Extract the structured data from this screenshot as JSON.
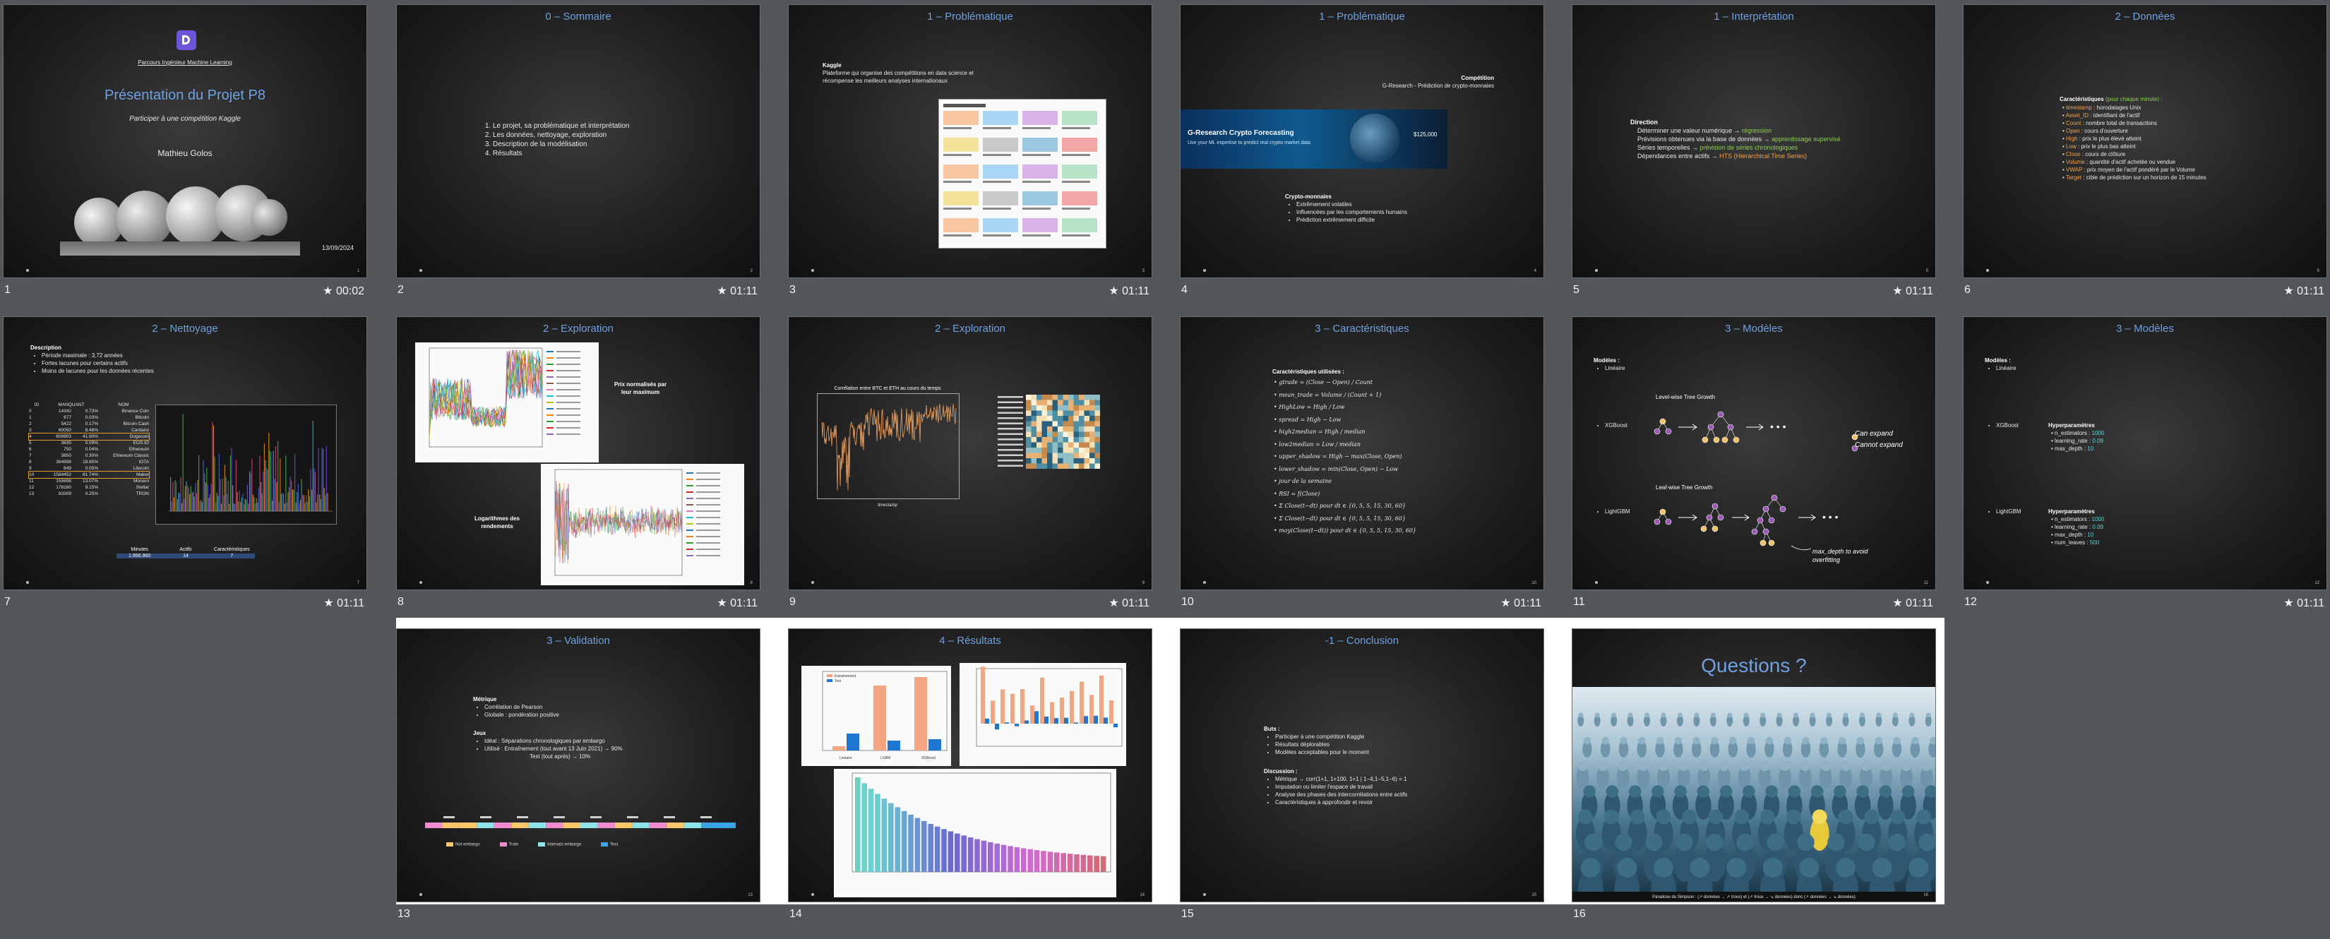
{
  "slides": [
    {
      "num": "1",
      "time": "★ 00:02",
      "slide_no": "1",
      "logo_org": "Parcours Ingénieur Machine Learning",
      "title": "Présentation du Projet P8",
      "subtitle": "Participer à une compétition Kaggle",
      "author": "Mathieu Golos",
      "date": "13/09/2024"
    },
    {
      "num": "2",
      "time": "★ 01:11",
      "title": "0 – Sommaire",
      "slide_no": "2",
      "items": [
        "Le projet, sa problématique et interprétation",
        "Les données, nettoyage, exploration",
        "Description de la modélisation",
        "Résultats"
      ]
    },
    {
      "num": "3",
      "time": "★ 01:11",
      "title": "1 – Problématique",
      "slide_no": "3",
      "kaggle_head": "Kaggle",
      "kaggle_text": "Plateforme qui organise des compétitions en data science et récompense les meilleurs analyses internationaux"
    },
    {
      "num": "4",
      "time": "",
      "title": "1 – Problématique",
      "slide_no": "4",
      "comp_head": "Compétition",
      "comp_text": "G-Research - Prédiction de crypto-monnaies",
      "banner_title": "G-Research Crypto Forecasting",
      "banner_sub": "Use your ML expertise to predict real crypto market data",
      "banner_prize": "$125,000",
      "crypto_head": "Crypto-monnaies",
      "crypto_items": [
        "Extrêmement volatiles",
        "Influencées par les comportements humains",
        "Prédiction extrêmement difficile"
      ]
    },
    {
      "num": "5",
      "time": "★ 01:11",
      "title": "1 – Interprétation",
      "slide_no": "5",
      "dir_head": "Direction",
      "lines": [
        {
          "a": "Déterminer une valeur numérique → ",
          "b": "régression",
          "cls": "hl-g"
        },
        {
          "a": "Prévisions obtenues via la base de données → ",
          "b": "apprentissage supervisé",
          "cls": "hl-g"
        },
        {
          "a": "Séries temporelles → ",
          "b": "prévision de séries chronologiques",
          "cls": "hl-g"
        },
        {
          "a": "Dépendances entre actifs → ",
          "b": "HTS (Hierarchical Time Series)",
          "cls": "hl-o"
        }
      ]
    },
    {
      "num": "6",
      "time": "★ 01:11",
      "title": "2 – Données",
      "slide_no": "6",
      "car_head": "Caractéristiques",
      "car_sub": "(pour chaque minute) :",
      "features": [
        {
          "k": "timestamp",
          "v": " : horodatages Unix"
        },
        {
          "k": "Asset_ID",
          "v": " : identifiant de l'actif"
        },
        {
          "k": "Count",
          "v": " : nombre total de transactions"
        },
        {
          "k": "Open",
          "v": " : cours d'ouverture"
        },
        {
          "k": "High",
          "v": " : prix le plus élevé atteint"
        },
        {
          "k": "Low",
          "v": " : prix le plus bas atteint"
        },
        {
          "k": "Close",
          "v": " : cours de clôture"
        },
        {
          "k": "Volume",
          "v": " : quantité d'actif achetée ou vendue"
        },
        {
          "k": "VWAP",
          "v": " : prix moyen de l'actif pondéré par le Volume"
        },
        {
          "k": "Target",
          "v": " : cible de prédiction sur un horizon de 15 minutes"
        }
      ]
    },
    {
      "num": "7",
      "time": "★ 01:11",
      "title": "2 – Nettoyage",
      "slide_no": "7",
      "desc_head": "Description",
      "desc_items": [
        "Période maximale : 3,72 années",
        "Fortes lacunes pour certains actifs",
        "Moins de lacunes pour les données récentes"
      ],
      "table_head": [
        "ID",
        "MANQUANT",
        "NOM"
      ],
      "table_rows": [
        [
          "0",
          "14342",
          "0.73%",
          "Binance Coin"
        ],
        [
          "1",
          "677",
          "0.03%",
          "Bitcoin"
        ],
        [
          "2",
          "5422",
          "0.17%",
          "Bitcoin Cash"
        ],
        [
          "3",
          "60050",
          "8.46%",
          "Cardano"
        ],
        [
          "4",
          "809903",
          "41.90%",
          "Dogecoin"
        ],
        [
          "5",
          "3835",
          "0.09%",
          "EOS.IO"
        ],
        [
          "6",
          "750",
          "0.04%",
          "Ethereum"
        ],
        [
          "7",
          "3850",
          "0.30%",
          "Ethereum Classic"
        ],
        [
          "8",
          "364898",
          "18.85%",
          "IOTA"
        ],
        [
          "9",
          "649",
          "0.05%",
          "Litecoin"
        ],
        [
          "10",
          "1584452",
          "81.74%",
          "Maker"
        ],
        [
          "11",
          "155698",
          "13.07%",
          "Monero"
        ],
        [
          "12",
          "178160",
          "9.15%",
          "Stellar"
        ],
        [
          "13",
          "83309",
          "4.25%",
          "TRON"
        ]
      ],
      "sum_head": [
        "Minutes",
        "Actifs",
        "Caractéristiques"
      ],
      "sum_vals": [
        "1.956.960",
        "14",
        "7"
      ]
    },
    {
      "num": "8",
      "time": "★ 01:11",
      "title": "2 – Exploration",
      "slide_no": "8",
      "lab1": "Prix normalisés par leur maximum",
      "lab2": "Logarithmes des rendements"
    },
    {
      "num": "9",
      "time": "★ 01:11",
      "title": "2 – Exploration",
      "slide_no": "9",
      "chart_title": "Corrélation entre BTC et ETH au cours du temps",
      "xlab": "timestamp"
    },
    {
      "num": "10",
      "time": "★ 01:11",
      "title": "3 – Caractéristiques",
      "slide_no": "10",
      "head": "Caractéristiques utilisées :",
      "formulas": [
        "gtrade = (Close − Open) / Count",
        "mean_trade = Volume / (Count + 1)",
        "HighLow = High / Low",
        "spread = High − Low",
        "high2median = High / median",
        "low2median = Low / median",
        "upper_shadow = High − max(Close, Open)",
        "lower_shadow = min(Close, Open) − Low",
        "jour de la semaine",
        "RSI = f(Close)",
        "Σ Close(t−dt) pour dt ∈ {0, 5, 5, 15, 30, 60}",
        "Σ Close(t−dt) pour dt ∈ {0, 5, 5, 15, 30, 60}",
        "moy(Close(t−dt)) pour dt ∈ {0, 5, 5, 15, 30, 60}"
      ]
    },
    {
      "num": "11",
      "time": "★ 01:11",
      "title": "3 – Modèles",
      "slide_no": "11",
      "models_head": "Modèles :",
      "m1": "Linéaire",
      "m2": "XGBoost",
      "m3": "LightGBM",
      "t1": "Level-wise Tree Growth",
      "t2": "Leaf-wise Tree Growth",
      "can": "Can expand",
      "cannot": "Cannot expand",
      "maxd": "max_depth to avoid overfitting"
    },
    {
      "num": "12",
      "time": "★ 01:11",
      "title": "3 – Modèles",
      "slide_no": "12",
      "models_head": "Modèles :",
      "m1": "Linéaire",
      "m2": "XGBoost",
      "m3": "LightGBM",
      "hp_head": "Hyperparamètres",
      "xgb": [
        {
          "k": "n_estimators : ",
          "v": "1000"
        },
        {
          "k": "learning_rate : ",
          "v": "0.09"
        },
        {
          "k": "max_depth : ",
          "v": "10"
        }
      ],
      "lgb": [
        {
          "k": "n_estimators : ",
          "v": "1000"
        },
        {
          "k": "learning_rate : ",
          "v": "0.09"
        },
        {
          "k": "max_depth : ",
          "v": "10"
        },
        {
          "k": "num_leaves : ",
          "v": "500"
        }
      ]
    },
    {
      "num": "13",
      "time": "",
      "title": "3 – Validation",
      "slide_no": "13",
      "met_head": "Métrique",
      "met_items": [
        "Corrélation de Pearson",
        "Globale : pondération positive"
      ],
      "jeux_head": "Jeux",
      "jeux_items": [
        "Idéal : Séparations chronologiques par embargo",
        "Utilisé : Entraînement (tout avant 13 Juin 2021) → 90%"
      ],
      "jeux_tail": "Test (tout après) → 10%",
      "legend": [
        "Not embargo",
        "Train",
        "Intervals embargo",
        "Test"
      ]
    },
    {
      "num": "14",
      "time": "",
      "title": "4 – Résultats",
      "slide_no": "14",
      "leg1": "Entraînement",
      "leg2": "Test",
      "cats": [
        "Linéaire",
        "LGBM",
        "XGBoost"
      ]
    },
    {
      "num": "15",
      "time": "",
      "title": "-1 – Conclusion",
      "slide_no": "15",
      "but_head": "Buts :",
      "but_items": [
        "Participer à une compétition Kaggle",
        "Résultats déplorables",
        "Modèles acceptables pour le moment"
      ],
      "disc_head": "Discussion :",
      "disc_items": [
        "Métrique → corr(1+1, 1+100, 1+1 | 1−4,1−5,1−6) = 1",
        "Imputation ou limiter l'espace de travail",
        "Analyse des phases des intercorrélations entre actifs",
        "Caractéristiques à approfondir et revoir"
      ]
    },
    {
      "num": "16",
      "time": "",
      "title": "Questions ?",
      "slide_no": "16",
      "caption": "Paradoxe du Simpson : (↗ données → ↗ trous) et (↗ trous → ↘ données) donc (↗ données → ↘ données)"
    }
  ]
}
